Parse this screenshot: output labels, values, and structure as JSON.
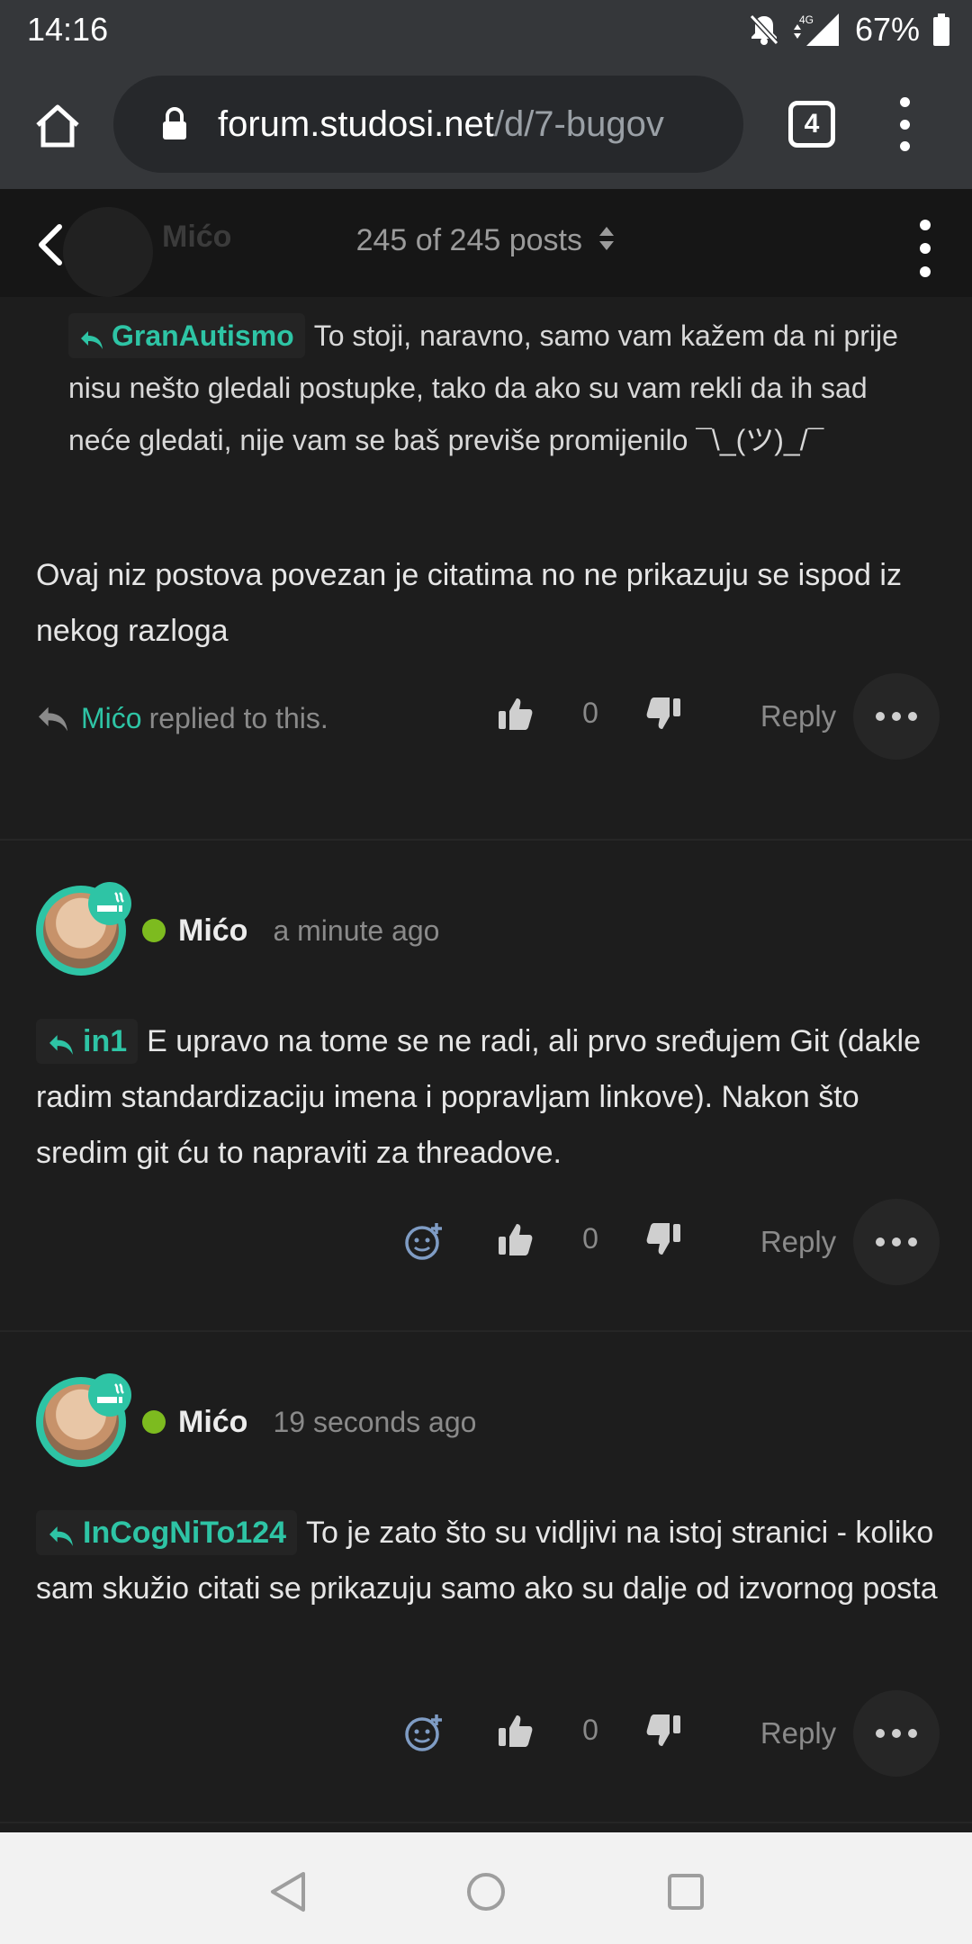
{
  "status_bar": {
    "time": "14:16",
    "network": "4G",
    "battery": "67%"
  },
  "browser": {
    "url_domain": "forum.studosi.net",
    "url_path": "/d/7-bugov",
    "tab_count": "4"
  },
  "forum_header": {
    "ghost_user": "Mićo",
    "scrubber": "245 of 245 posts"
  },
  "colors": {
    "accent": "#2ec4a5",
    "online": "#7dbb1f",
    "background": "#1d1d1d"
  },
  "post1": {
    "mention": "GranAutismo",
    "quote_text": "To stoji, naravno, samo vam kažem da ni prije nisu nešto gledali postupke, tako da ako su vam rekli da ih sad neće gledati, nije vam se baš previše promijenilo ¯\\_(ツ)_/¯",
    "body": "Ovaj niz postova povezan je citatima no ne prikazuju se ispod iz nekog razloga",
    "replied_user": "Mićo",
    "replied_suffix": "replied to this.",
    "likes": "0",
    "reply_label": "Reply"
  },
  "post2": {
    "username": "Mićo",
    "time_ago": "a minute ago",
    "mention": "in1",
    "body": "E upravo na tome se ne radi, ali prvo sređujem Git (dakle radim standardizaciju imena i popravljam linkove). Nakon što sredim git ću to napraviti za threadove.",
    "likes": "0",
    "reply_label": "Reply"
  },
  "post3": {
    "username": "Mićo",
    "time_ago": "19 seconds ago",
    "mention": "InCogNiTo124",
    "body": "To je zato što su vidljivi na istoj stranici - koliko sam skužio citati se prikazuju samo ako su dalje od izvornog posta",
    "likes": "0",
    "reply_label": "Reply"
  }
}
